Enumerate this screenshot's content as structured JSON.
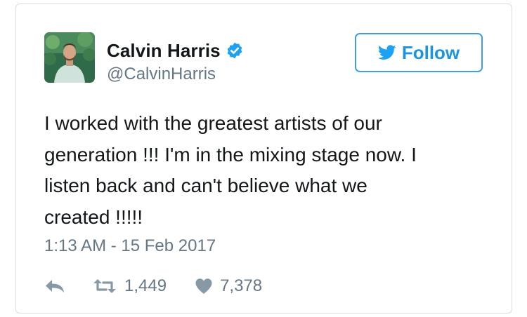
{
  "user": {
    "display_name": "Calvin Harris",
    "handle": "@CalvinHarris",
    "verified": true,
    "avatar_icon": "profile-photo"
  },
  "follow_button": {
    "label": "Follow",
    "icon": "twitter-bird-icon"
  },
  "tweet": {
    "lines": [
      "I worked with the greatest artists of our",
      "generation !!! I'm in the mixing stage now. I",
      "listen back and can't believe what we",
      "created !!!!!"
    ],
    "timestamp": "1:13 AM - 15 Feb 2017"
  },
  "actions": {
    "reply_icon": "reply-arrow-icon",
    "retweet_icon": "retweet-icon",
    "retweet_count": "1,449",
    "like_icon": "heart-icon",
    "like_count": "7,378"
  },
  "colors": {
    "accent": "#1da1f2",
    "text": "#14171a",
    "secondary_text": "#657786",
    "icon_gray": "#8899a6",
    "border": "#d9dde1"
  }
}
